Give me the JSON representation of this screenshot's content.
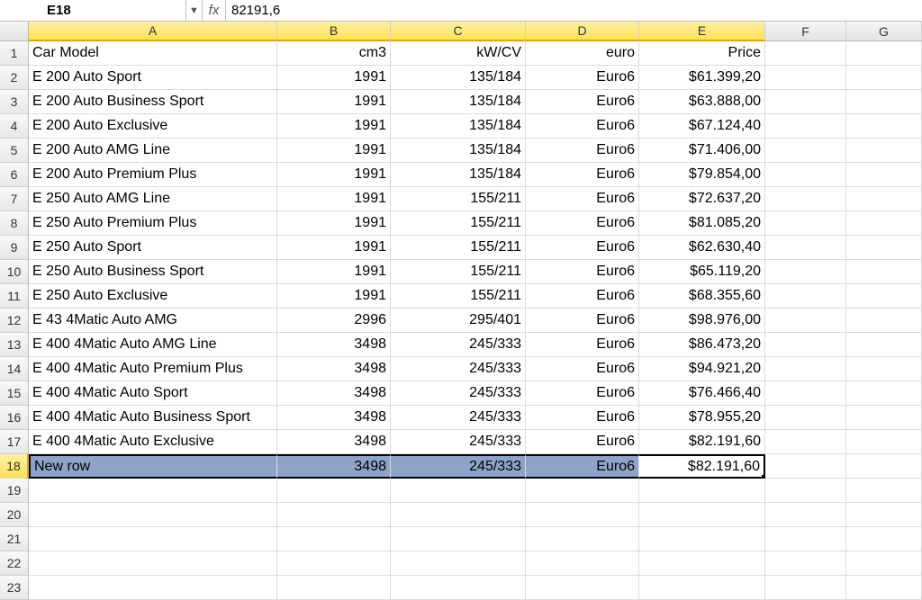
{
  "formula_bar": {
    "name_box": "E18",
    "fx": "fx",
    "formula": "82191,6"
  },
  "columns": [
    "A",
    "B",
    "C",
    "D",
    "E",
    "F",
    "G"
  ],
  "highlight_cols": [
    "A",
    "B",
    "C",
    "D",
    "E"
  ],
  "chart_data": {
    "type": "table",
    "columns": [
      "Car Model",
      "cm3",
      "kW/CV",
      "euro",
      "Price"
    ],
    "rows": [
      [
        "E 200 Auto Sport",
        "1991",
        "135/184",
        "Euro6",
        "$61.399,20"
      ],
      [
        "E 200 Auto Business Sport",
        "1991",
        "135/184",
        "Euro6",
        "$63.888,00"
      ],
      [
        "E 200 Auto Exclusive",
        "1991",
        "135/184",
        "Euro6",
        "$67.124,40"
      ],
      [
        "E 200 Auto AMG Line",
        "1991",
        "135/184",
        "Euro6",
        "$71.406,00"
      ],
      [
        "E 200 Auto Premium Plus",
        "1991",
        "135/184",
        "Euro6",
        "$79.854,00"
      ],
      [
        "E 250 Auto AMG Line",
        "1991",
        "155/211",
        "Euro6",
        "$72.637,20"
      ],
      [
        "E 250 Auto Premium Plus",
        "1991",
        "155/211",
        "Euro6",
        "$81.085,20"
      ],
      [
        "E 250 Auto Sport",
        "1991",
        "155/211",
        "Euro6",
        "$62.630,40"
      ],
      [
        "E 250 Auto Business Sport",
        "1991",
        "155/211",
        "Euro6",
        "$65.119,20"
      ],
      [
        "E 250 Auto Exclusive",
        "1991",
        "155/211",
        "Euro6",
        "$68.355,60"
      ],
      [
        "E 43 4Matic Auto AMG",
        "2996",
        "295/401",
        "Euro6",
        "$98.976,00"
      ],
      [
        "E 400 4Matic Auto AMG Line",
        "3498",
        "245/333",
        "Euro6",
        "$86.473,20"
      ],
      [
        "E 400 4Matic Auto Premium Plus",
        "3498",
        "245/333",
        "Euro6",
        "$94.921,20"
      ],
      [
        "E 400 4Matic Auto Sport",
        "3498",
        "245/333",
        "Euro6",
        "$76.466,40"
      ],
      [
        "E 400 4Matic Auto Business Sport",
        "3498",
        "245/333",
        "Euro6",
        "$78.955,20"
      ],
      [
        "E 400 4Matic Auto Exclusive",
        "3498",
        "245/333",
        "Euro6",
        "$82.191,60"
      ],
      [
        "New row",
        "3498",
        "245/333",
        "Euro6",
        "$82.191,60"
      ]
    ]
  },
  "selected_row": 18,
  "active_cell": "E18",
  "empty_rows": [
    19,
    20,
    21,
    22,
    23
  ]
}
